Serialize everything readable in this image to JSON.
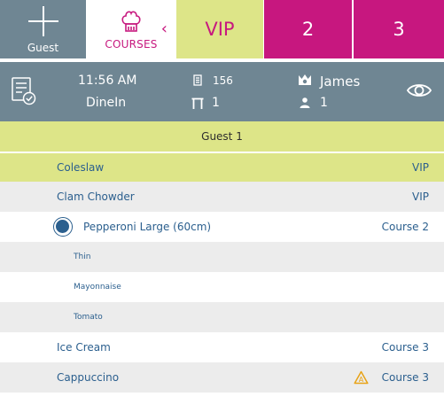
{
  "tabs": {
    "guest_label": "Guest",
    "courses_label": "COURSES",
    "vip_label": "VIP",
    "tab2_label": "2",
    "tab3_label": "3"
  },
  "info": {
    "time": "11:56 AM",
    "mode": "DineIn",
    "order_number": "156",
    "table_number": "1",
    "staff_name": "James",
    "covers": "1"
  },
  "guest_header": "Guest 1",
  "items": [
    {
      "name": "Coleslaw",
      "course": "VIP"
    },
    {
      "name": "Clam Chowder",
      "course": "VIP"
    },
    {
      "name": "Pepperoni Large (60cm)",
      "course": "Course 2"
    },
    {
      "name": "Thin"
    },
    {
      "name": "Mayonnaise"
    },
    {
      "name": "Tomato"
    },
    {
      "name": "Ice Cream",
      "course": "Course 3"
    },
    {
      "name": "Cappuccino",
      "course": "Course 3"
    }
  ],
  "colors": {
    "slate": "#6f8693",
    "lime": "#dde588",
    "magenta": "#c7177f",
    "item_text": "#2b5f8e",
    "warning": "#e8a317"
  },
  "icons": {
    "guest_tab": "plus-icon",
    "courses_tab": "chef-hat-icon",
    "back": "chevron-left-icon",
    "order": "order-checklist-icon",
    "order_number": "receipt-icon",
    "table": "table-icon",
    "staff": "crown-icon",
    "covers": "person-icon",
    "view": "eye-icon",
    "warning": "warning-triangle-icon"
  }
}
